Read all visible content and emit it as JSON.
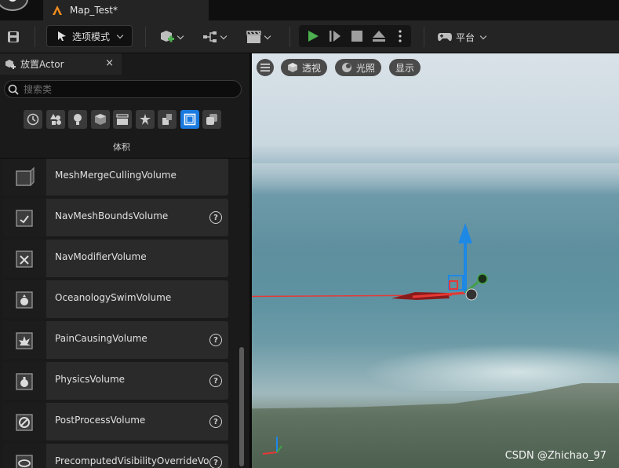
{
  "titlebar": {
    "tab_label": "Map_Test*"
  },
  "toolbar": {
    "mode_label": "选项模式",
    "platform_label": "平台"
  },
  "panel": {
    "tab_label": "放置Actor",
    "close_glyph": "×",
    "search_placeholder": "搜索类",
    "category_icons": [
      "clock-icon",
      "shapes-icon",
      "light-icon",
      "cube-icon",
      "cinematic-icon",
      "visual-effects-icon",
      "geometry-icon",
      "volume-icon",
      "all-classes-icon"
    ],
    "active_category_label": "体积",
    "items": [
      {
        "label": "MeshMergeCullingVolume",
        "help": false
      },
      {
        "label": "NavMeshBoundsVolume",
        "help": true
      },
      {
        "label": "NavModifierVolume",
        "help": false
      },
      {
        "label": "OceanologySwimVolume",
        "help": false
      },
      {
        "label": "PainCausingVolume",
        "help": true
      },
      {
        "label": "PhysicsVolume",
        "help": true
      },
      {
        "label": "PostProcessVolume",
        "help": true
      },
      {
        "label": "PrecomputedVisibilityOverrideVo",
        "help": true
      }
    ],
    "help_glyph": "?"
  },
  "viewport": {
    "menu_icon": "hamburger-icon",
    "perspective_label": "透视",
    "lighting_label": "光照",
    "show_label": "显示"
  },
  "watermark": "CSDN @Zhichao_97",
  "colors": {
    "accent": "#1a7ae0",
    "play": "#4caf50",
    "gizmo_x": "#e53935",
    "gizmo_y": "#43a047",
    "gizmo_z": "#1e88e5"
  }
}
